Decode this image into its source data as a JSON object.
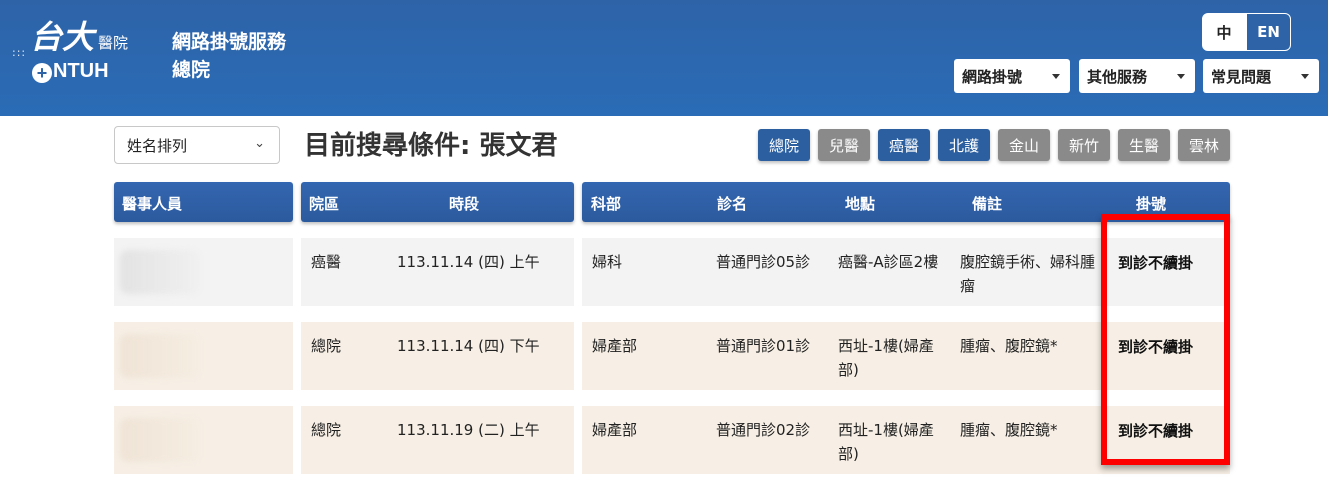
{
  "header": {
    "logo_main": "台大",
    "logo_sub": "醫院",
    "logo_ntuh": "NTUH",
    "site_title": "網路掛號服務",
    "site_subtitle": "總院",
    "lang_zh": "中",
    "lang_en": "EN",
    "menus": [
      "網路掛號",
      "其他服務",
      "常見問題"
    ]
  },
  "filters": {
    "sort_value": "姓名排列",
    "search_title": "目前搜尋條件: 張文君",
    "campuses": [
      {
        "label": "總院",
        "active": true
      },
      {
        "label": "兒醫",
        "active": false
      },
      {
        "label": "癌醫",
        "active": true
      },
      {
        "label": "北護",
        "active": true
      },
      {
        "label": "金山",
        "active": false
      },
      {
        "label": "新竹",
        "active": false
      },
      {
        "label": "生醫",
        "active": false
      },
      {
        "label": "雲林",
        "active": false
      }
    ]
  },
  "table": {
    "headers": {
      "staff": "醫事人員",
      "campus": "院區",
      "period": "時段",
      "dept": "科部",
      "clinic": "診名",
      "location": "地點",
      "note": "備註",
      "register": "掛號"
    },
    "rows": [
      {
        "campus": "癌醫",
        "period": "113.11.14 (四) 上午",
        "dept": "婦科",
        "clinic": "普通門診05診",
        "location_1": "癌醫-A診區2樓",
        "location_2": "",
        "note_1": "腹腔鏡手術、婦科腫",
        "note_2": "瘤",
        "register": "到診不續掛"
      },
      {
        "campus": "總院",
        "period": "113.11.14 (四) 下午",
        "dept": "婦產部",
        "clinic": "普通門診01診",
        "location_1": "西址-1樓(婦產",
        "location_2": "部)",
        "note_1": "腫瘤、腹腔鏡*",
        "note_2": "",
        "register": "到診不續掛"
      },
      {
        "campus": "總院",
        "period": "113.11.19 (二) 上午",
        "dept": "婦產部",
        "clinic": "普通門診02診",
        "location_1": "西址-1樓(婦產",
        "location_2": "部)",
        "note_1": "腫瘤、腹腔鏡*",
        "note_2": "",
        "register": "到診不續掛"
      }
    ]
  },
  "colors": {
    "header_blue": "#2e63a8",
    "campus_active": "#2b5fa0",
    "campus_inactive": "#8a8a8a",
    "row_alt": "#f7efe5",
    "highlight": "#ff0000"
  }
}
